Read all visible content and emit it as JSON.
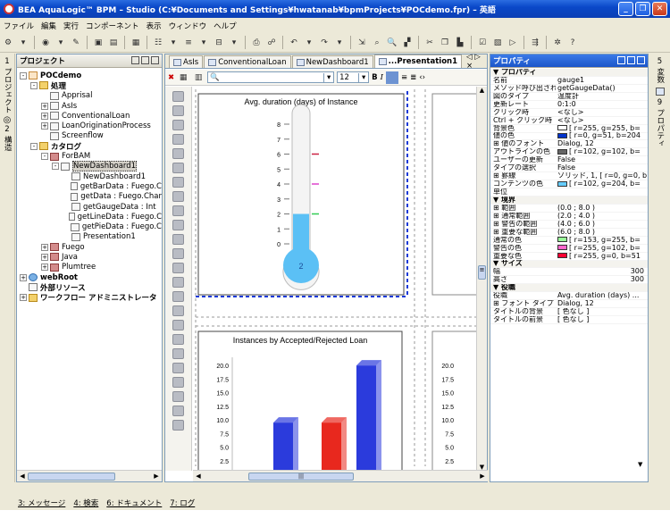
{
  "window": {
    "title": "BEA AquaLogic™ BPM – Studio  (C:¥Documents and Settings¥hwatanab¥bpmProjects¥POCdemo.fpr) – 英語"
  },
  "menu": [
    "ファイル",
    "編集",
    "実行",
    "コンポーネント",
    "表示",
    "ウィンドウ",
    "ヘルプ"
  ],
  "left_strip": [
    "1",
    "プロジェクト",
    "2",
    "構造"
  ],
  "project_panel": {
    "title": "プロジェクト",
    "tree": [
      {
        "label": "POCdemo",
        "level": 0,
        "expander": "-",
        "icon": "proc",
        "bold": true
      },
      {
        "label": "処理",
        "level": 1,
        "expander": "-",
        "icon": "folder",
        "bold": true
      },
      {
        "label": "Apprisal",
        "level": 2,
        "expander": "",
        "icon": "doc"
      },
      {
        "label": "AsIs",
        "level": 2,
        "expander": "+",
        "icon": "doc"
      },
      {
        "label": "ConventionalLoan",
        "level": 2,
        "expander": "+",
        "icon": "doc"
      },
      {
        "label": "LoanOriginationProcess",
        "level": 2,
        "expander": "+",
        "icon": "doc"
      },
      {
        "label": "Screenflow",
        "level": 2,
        "expander": "",
        "icon": "doc"
      },
      {
        "label": "カタログ",
        "level": 1,
        "expander": "-",
        "icon": "folder",
        "bold": true
      },
      {
        "label": "ForBAM",
        "level": 2,
        "expander": "-",
        "icon": "pkg"
      },
      {
        "label": "NewDashboard1",
        "level": 3,
        "expander": "-",
        "icon": "doc",
        "selected": true
      },
      {
        "label": "NewDashboard1",
        "level": 4,
        "expander": "",
        "icon": "doc"
      },
      {
        "label": "getBarData : Fuego.C",
        "level": 4,
        "expander": "",
        "icon": "doc"
      },
      {
        "label": "getData : Fuego.Char",
        "level": 4,
        "expander": "",
        "icon": "doc"
      },
      {
        "label": "getGaugeData : Int",
        "level": 4,
        "expander": "",
        "icon": "doc"
      },
      {
        "label": "getLineData : Fuego.C",
        "level": 4,
        "expander": "",
        "icon": "doc"
      },
      {
        "label": "getPieData : Fuego.C",
        "level": 4,
        "expander": "",
        "icon": "doc"
      },
      {
        "label": "Presentation1",
        "level": 4,
        "expander": "",
        "icon": "doc"
      },
      {
        "label": "Fuego",
        "level": 2,
        "expander": "+",
        "icon": "pkg"
      },
      {
        "label": "Java",
        "level": 2,
        "expander": "+",
        "icon": "pkg"
      },
      {
        "label": "Plumtree",
        "level": 2,
        "expander": "+",
        "icon": "pkg"
      },
      {
        "label": "webRoot",
        "level": 0,
        "expander": "+",
        "icon": "globe",
        "bold": true
      },
      {
        "label": "外部リソース",
        "level": 0,
        "expander": "",
        "icon": "doc",
        "bold": true
      },
      {
        "label": "ワークフロー アドミニストレータ",
        "level": 0,
        "expander": "+",
        "icon": "folder",
        "bold": true
      }
    ]
  },
  "editor": {
    "tabs": [
      "AsIs",
      "ConventionalLoan",
      "NewDashboard1",
      "...Presentation1"
    ],
    "active_tab": 3,
    "font_size": "12",
    "tab_nav": "◁ ▷ ×"
  },
  "gauge": {
    "title": "Avg. duration (days) of Instance",
    "value": 2,
    "max": 8,
    "ticks": [
      "8",
      "7",
      "6",
      "5",
      "4",
      "3",
      "2",
      "1",
      "0"
    ],
    "markers": [
      {
        "at": 6,
        "color": "#cc2244"
      },
      {
        "at": 4,
        "color": "#dd44cc"
      },
      {
        "at": 2,
        "color": "#33cc55"
      }
    ]
  },
  "bar_chart": {
    "title": "Instances by Accepted/Rejected Loan",
    "y_ticks": [
      "20.0",
      "17.5",
      "15.0",
      "12.5",
      "10.0",
      "7.5",
      "5.0",
      "2.5"
    ],
    "second_y_ticks": [
      "20.0",
      "17.5",
      "15.0",
      "12.5",
      "10.0",
      "7.5",
      "5.0",
      "2.5"
    ]
  },
  "chart_data": {
    "type": "bar",
    "title": "Instances by Accepted/Rejected Loan",
    "categories": [
      "",
      "",
      ""
    ],
    "values": [
      9.5,
      9.5,
      20
    ],
    "colors": [
      "#2b3bdc",
      "#e8281e",
      "#2b3bdc"
    ],
    "ylim": [
      0,
      21.5
    ]
  },
  "props_panel": {
    "title": "プロパティ",
    "rows": [
      {
        "k": "▼ プロパティ",
        "cat": true
      },
      {
        "k": "名前",
        "v": "gauge1"
      },
      {
        "k": "メソッド呼び出され",
        "v": "getGaugeData()"
      },
      {
        "k": "図のタイプ",
        "v": "温度計"
      },
      {
        "k": "更新レート",
        "v": "0:1:0"
      },
      {
        "k": "クリック時",
        "v": "<なし>"
      },
      {
        "k": "Ctrl + クリック時",
        "v": "<なし>"
      },
      {
        "k": "背景色",
        "v": "[ r=255, g=255, b=",
        "sw": "#ffffff"
      },
      {
        "k": "値の色",
        "v": "[ r=0, g=51, b=204",
        "sw": "#0033cc"
      },
      {
        "k": "⊞ 値のフォント",
        "v": "Dialog, 12"
      },
      {
        "k": "アウトラインの色",
        "v": "[ r=102, g=102, b=",
        "sw": "#666666"
      },
      {
        "k": "ユーザーの更新",
        "v": "False"
      },
      {
        "k": "タイプの選択",
        "v": "False"
      },
      {
        "k": "⊞ 罫線",
        "v": "ソリッド, 1, [ r=0, g=0, b="
      },
      {
        "k": "コンテンツの色",
        "v": "[ r=102, g=204, b=",
        "sw": "#66ccff"
      },
      {
        "k": "単位",
        "v": ""
      },
      {
        "k": "▼ 境界",
        "cat": true
      },
      {
        "k": "⊞ 範囲",
        "v": "(0.0 ; 8.0 )"
      },
      {
        "k": "⊞ 通常範囲",
        "v": "(2.0 ; 4.0 )"
      },
      {
        "k": "⊞ 警告の範囲",
        "v": "(4.0 ; 6.0 )"
      },
      {
        "k": "⊞ 重要な範囲",
        "v": "(6.0 ; 8.0 )"
      },
      {
        "k": "通常の色",
        "v": "[ r=153, g=255, b=",
        "sw": "#99ff99"
      },
      {
        "k": "警告の色",
        "v": "[ r=255, g=102, b=",
        "sw": "#ff66cc"
      },
      {
        "k": "重要な色",
        "v": "[ r=255, g=0, b=51",
        "sw": "#ff0033"
      },
      {
        "k": "▼ サイズ",
        "cat": true
      },
      {
        "k": "幅",
        "v": "300",
        "right": true
      },
      {
        "k": "高さ",
        "v": "300",
        "right": true
      },
      {
        "k": "▼ 役職",
        "cat": true
      },
      {
        "k": "役職",
        "v": "Avg. duration (days) ..."
      },
      {
        "k": "⊞ フォント タイプ",
        "v": "Dialog, 12"
      },
      {
        "k": "タイトルの背景",
        "v": "[ 色なし ]"
      },
      {
        "k": "タイトルの前景",
        "v": "[ 色なし ]"
      }
    ]
  },
  "right_strip": [
    "5",
    "変数",
    "9",
    "プロパティ"
  ],
  "status_bar": [
    "3: メッセージ",
    "4: 検索",
    "6: ドキュメント",
    "7: ログ"
  ]
}
